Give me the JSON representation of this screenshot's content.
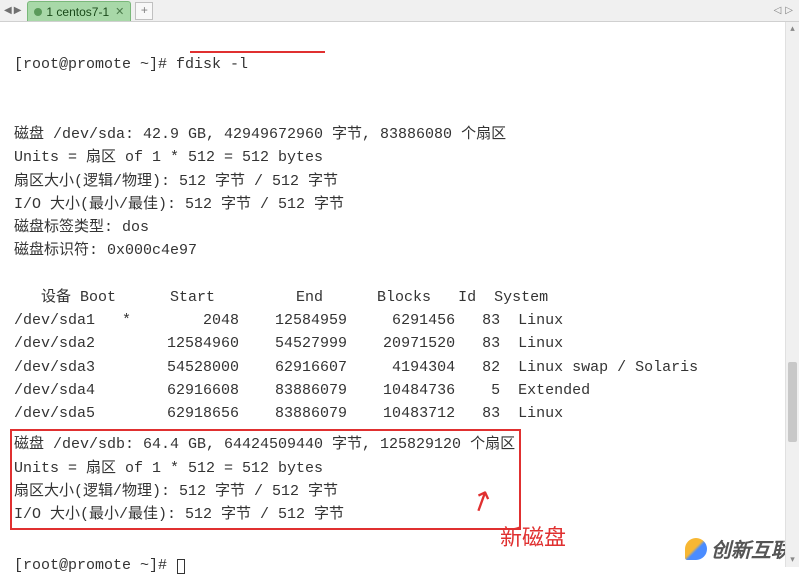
{
  "tab": {
    "label": "1 centos7-1"
  },
  "prompt": "[root@promote ~]# ",
  "cmd": "fdisk -l",
  "sda": {
    "line1": "磁盘 /dev/sda: 42.9 GB, 42949672960 字节, 83886080 个扇区",
    "line2": "Units = 扇区 of 1 * 512 = 512 bytes",
    "line3": "扇区大小(逻辑/物理): 512 字节 / 512 字节",
    "line4": "I/O 大小(最小/最佳): 512 字节 / 512 字节",
    "line5": "磁盘标签类型: dos",
    "line6": "磁盘标识符: 0x000c4e97"
  },
  "header": "   设备 Boot      Start         End      Blocks   Id  System",
  "rows": [
    "/dev/sda1   *        2048    12584959     6291456   83  Linux",
    "/dev/sda2        12584960    54527999    20971520   83  Linux",
    "/dev/sda3        54528000    62916607     4194304   82  Linux swap / Solaris",
    "/dev/sda4        62916608    83886079    10484736    5  Extended",
    "/dev/sda5        62918656    83886079    10483712   83  Linux"
  ],
  "sdb": {
    "line1": "磁盘 /dev/sdb: 64.4 GB, 64424509440 字节, 125829120 个扇区",
    "line2": "Units = 扇区 of 1 * 512 = 512 bytes",
    "line3": "扇区大小(逻辑/物理): 512 字节 / 512 字节",
    "line4": "I/O 大小(最小/最佳): 512 字节 / 512 字节"
  },
  "annotation": "新磁盘",
  "watermark": "创新互联"
}
